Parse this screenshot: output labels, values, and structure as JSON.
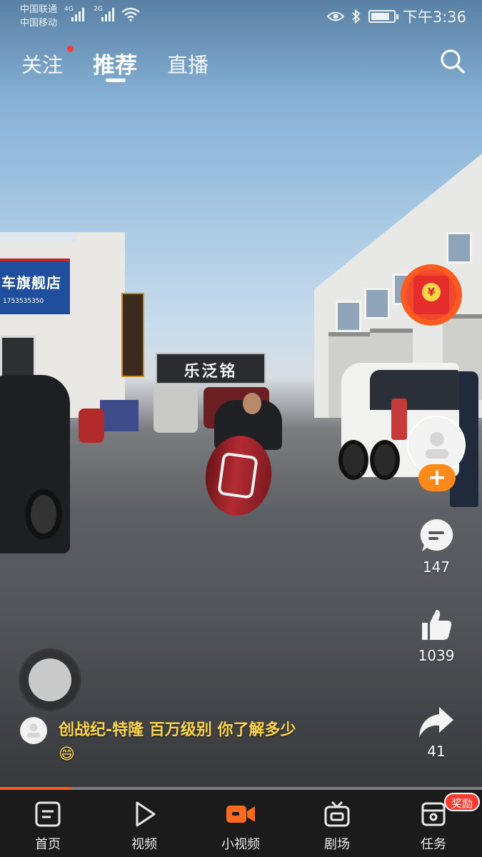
{
  "status_bar": {
    "carrier_1": "中国联通",
    "carrier_2": "中国移动",
    "network_1": "4G",
    "network_2": "2G",
    "time": "下午3:36",
    "battery_level": 0.85
  },
  "top_nav": {
    "tabs": [
      {
        "label": "关注",
        "has_dot": true
      },
      {
        "label": "推荐",
        "active": true
      },
      {
        "label": "直播"
      }
    ],
    "search_icon": "search-icon"
  },
  "video": {
    "store_sign": "乐泛铭",
    "left_sign": "车旗舰店",
    "left_sign_phone": "1753535350"
  },
  "actions": {
    "redpacket_symbol": "¥",
    "follow_symbol": "+",
    "comments": "147",
    "likes": "1039",
    "shares": "41"
  },
  "caption": {
    "text": "创战纪-特隆 百万级别 你了解多少",
    "emoji": "😄"
  },
  "progress": {
    "played_fraction": 0.15
  },
  "bottom_nav": {
    "items": [
      {
        "label": "首页",
        "icon": "home-icon"
      },
      {
        "label": "视频",
        "icon": "play-icon"
      },
      {
        "label": "小视频",
        "icon": "camera-icon",
        "active": true
      },
      {
        "label": "剧场",
        "icon": "tv-icon"
      },
      {
        "label": "任务",
        "icon": "task-icon"
      }
    ],
    "reward_badge": "奖励"
  },
  "colors": {
    "accent": "#ff5a1f",
    "caption": "#ffd54a",
    "follow": "#ff8a1a",
    "badge": "#ff3b30"
  }
}
